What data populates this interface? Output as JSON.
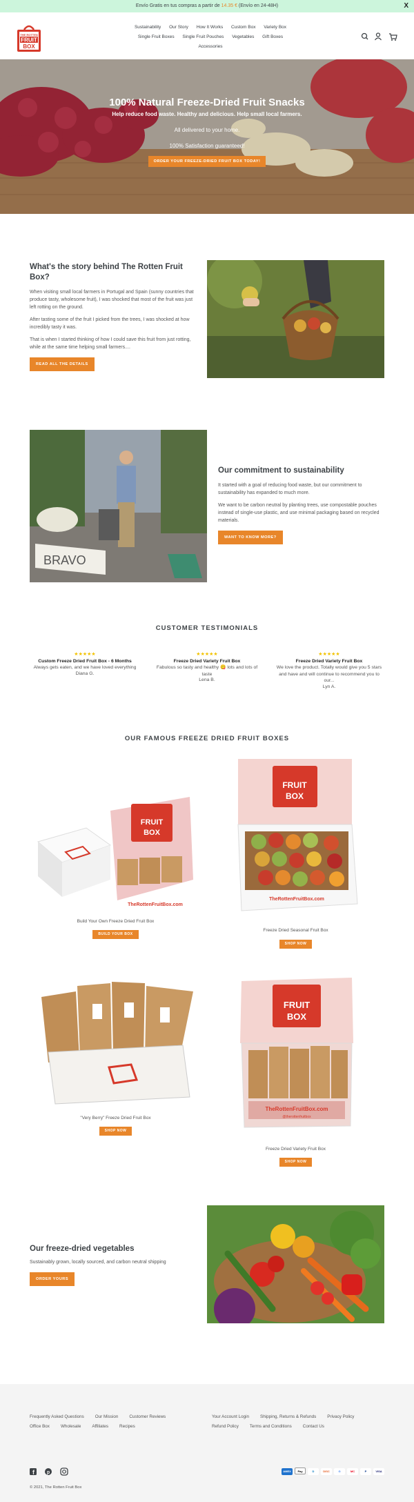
{
  "announcement": {
    "before": "Envío Gratis en tus compras a partir de ",
    "amount": "14.35 €",
    "after": " (Envío en 24-48H)",
    "close": "X"
  },
  "brand": {
    "logo_lines": [
      "THE ROTTEN",
      "FRUIT",
      "BOX"
    ]
  },
  "nav": {
    "row1": [
      "Sustainability",
      "Our Story",
      "How It Works",
      "Custom Box",
      "Variety Box"
    ],
    "row2": [
      "Single Fruit Boxes",
      "Single Fruit Pouches",
      "Vegetables",
      "Gift Boxes"
    ],
    "row3": [
      "Accessories"
    ]
  },
  "hero": {
    "title": "100% Natural Freeze-Dried Fruit Snacks",
    "line1": "Help reduce food waste. Healthy and delicious. Help small local farmers.",
    "line2": "All delivered to your home.",
    "line3": "100% Satisfaction guaranteed!",
    "cta": "ORDER YOUR FREEZE-DRIED FRUIT BOX TODAY!"
  },
  "story": {
    "title": "What's the story behind The Rotten Fruit Box?",
    "p1": "When visiting small local farmers in Portugal and Spain (sunny countries that produce tasty, wholesome fruit), I was shocked that most of the fruit was just left rotting on the ground.",
    "p2": "After tasting some of the fruit I picked from the trees, I was shocked at how incredibly tasty it was.",
    "p3": "That is when I started thinking of how I could save this fruit from just rotting, while at the same time helping small farmers....",
    "cta": "READ ALL THE DETAILS"
  },
  "commit": {
    "title": "Our commitment to sustainability",
    "p1": "It started with a goal of reducing food waste, but our commitment to sustainability has expanded to much more.",
    "p2": "We want to be carbon neutral by planting trees, use compostable pouches instead of single-use plastic, and use minimal packaging based on recycled materials.",
    "cta": "WANT TO KNOW MORE?",
    "sign": "BRAVO"
  },
  "testimonials": {
    "title": "CUSTOMER TESTIMONIALS",
    "items": [
      {
        "stars": "★★★★★",
        "product": "Custom Freeze Dried Fruit Box - 6 Months",
        "text": "Always gets eaten, and we have loved everything",
        "name": "Diana G."
      },
      {
        "stars": "★★★★★",
        "product": "Freeze Dried Variety Fruit Box",
        "text": "Fabulous so tasty and healthy 😋 lots and lots of taste",
        "name": "Lena B."
      },
      {
        "stars": "★★★★★",
        "product": "Freeze Dried Variety Fruit Box",
        "text": "We love the product. Totally would give you 5 stars and have and will continue to recommend you to our...",
        "name": "Lyn A."
      }
    ]
  },
  "boxes": {
    "title": "OUR FAMOUS FREEZE DRIED FRUIT BOXES",
    "items": [
      {
        "name": "Build Your Own Freeze Dried Fruit Box",
        "cta": "BUILD YOUR BOX"
      },
      {
        "name": "Freeze Dried Seasonal Fruit Box",
        "cta": "SHOP NOW"
      },
      {
        "name": "\"Very Berry\" Freeze Dried Fruit Box",
        "cta": "SHOP NOW"
      },
      {
        "name": "Freeze Dried Variety Fruit Box",
        "cta": "SHOP NOW"
      }
    ],
    "box_url": "TheRottenFruitBox.com",
    "box_tag": "@therottenfruitbox"
  },
  "veg": {
    "title": "Our freeze-dried vegetables",
    "text": "Sustainably grown, locally sourced, and carbon neutral shipping",
    "cta": "ORDER YOURS"
  },
  "footer": {
    "col1": [
      "Frequently Asked Questions",
      "Our Mission",
      "Customer Reviews",
      "Office Box",
      "Wholesale",
      "Affiliates",
      "Recipes"
    ],
    "col2": [
      "Your Account Login",
      "Shipping, Returns & Refunds",
      "Privacy Policy",
      "Refund Policy",
      "Terms and Conditions",
      "Contact Us"
    ],
    "copyright": "© 2021, The Rotten Fruit Box",
    "payments": [
      "AMEX",
      "Pay",
      "D",
      "DISC",
      "G",
      "MC",
      "P",
      "VISA"
    ]
  },
  "colors": {
    "accent": "#e8862a",
    "brand_red": "#d6392a",
    "announce_bg": "#ccf5dc"
  }
}
